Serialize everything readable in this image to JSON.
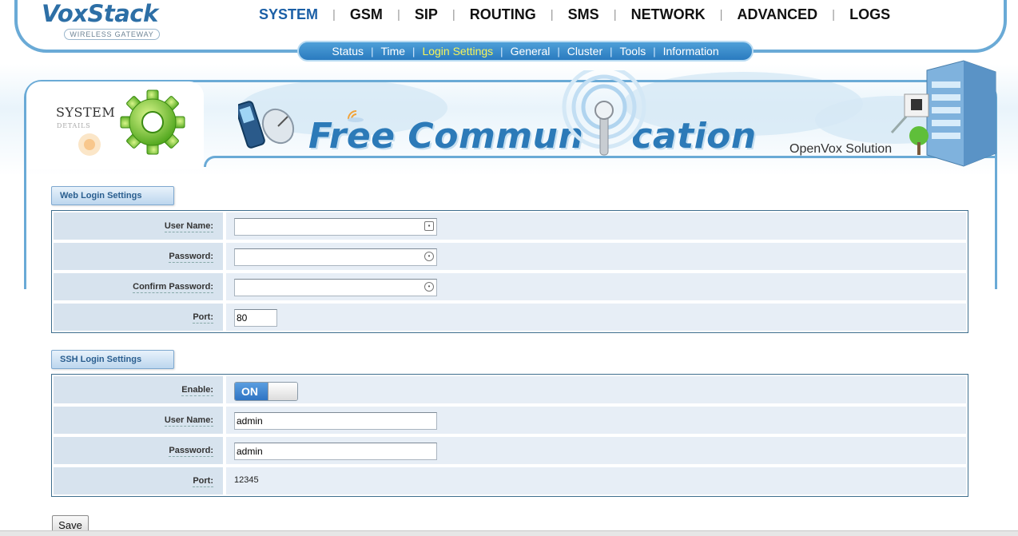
{
  "header": {
    "logo_title": "VoxStack",
    "logo_subtitle": "WIRELESS GATEWAY"
  },
  "topnav": [
    {
      "label": "SYSTEM",
      "active": true
    },
    {
      "label": "GSM"
    },
    {
      "label": "SIP"
    },
    {
      "label": "ROUTING"
    },
    {
      "label": "SMS"
    },
    {
      "label": "NETWORK"
    },
    {
      "label": "ADVANCED"
    },
    {
      "label": "LOGS"
    }
  ],
  "subnav": [
    {
      "label": "Status"
    },
    {
      "label": "Time"
    },
    {
      "label": "Login Settings",
      "active": true
    },
    {
      "label": "General"
    },
    {
      "label": "Cluster"
    },
    {
      "label": "Tools"
    },
    {
      "label": "Information"
    }
  ],
  "banner": {
    "section_label": "SYSTEM",
    "section_sublabel": "DETAILS",
    "headline_left": "Free Commun",
    "headline_right": "cation",
    "brand_text": "OpenVox Solution"
  },
  "web_login": {
    "title": "Web Login Settings",
    "user_name_label": "User Name:",
    "user_name_value": "",
    "password_label": "Password:",
    "password_value": "",
    "confirm_password_label": "Confirm Password:",
    "confirm_password_value": "",
    "port_label": "Port:",
    "port_value": "80"
  },
  "ssh_login": {
    "title": "SSH Login Settings",
    "enable_label": "Enable:",
    "enable_state": "ON",
    "user_name_label": "User Name:",
    "user_name_value": "admin",
    "password_label": "Password:",
    "password_value": "admin",
    "port_label": "Port:",
    "port_value": "12345"
  },
  "actions": {
    "save_label": "Save"
  },
  "colors": {
    "accent": "#2d6fa6",
    "subnav_active": "#f5f35a",
    "frame": "#6aaad6"
  }
}
